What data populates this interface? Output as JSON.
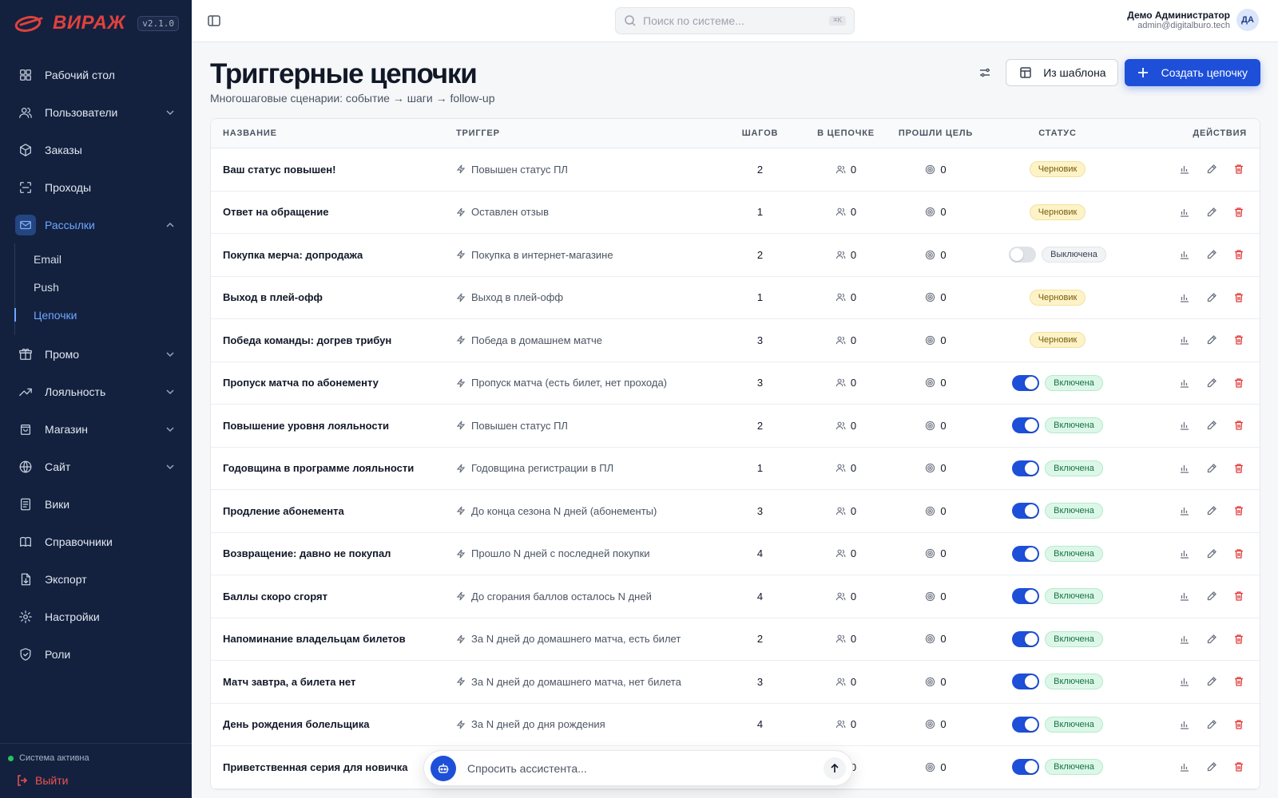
{
  "brand": {
    "name": "ВИРАЖ",
    "version": "v2.1.0"
  },
  "nav": {
    "items": [
      {
        "label": "Рабочий стол",
        "icon": "dashboard-icon"
      },
      {
        "label": "Пользователи",
        "icon": "users-icon",
        "expandable": true
      },
      {
        "label": "Заказы",
        "icon": "box-icon"
      },
      {
        "label": "Проходы",
        "icon": "scan-icon"
      },
      {
        "label": "Рассылки",
        "icon": "mail-icon",
        "expandable": true,
        "active": true,
        "expanded": true
      },
      {
        "label": "Промо",
        "icon": "gift-icon",
        "expandable": true
      },
      {
        "label": "Лояльность",
        "icon": "trending-up-icon",
        "expandable": true
      },
      {
        "label": "Магазин",
        "icon": "shopping-bag-icon",
        "expandable": true
      },
      {
        "label": "Сайт",
        "icon": "globe-icon",
        "expandable": true
      },
      {
        "label": "Вики",
        "icon": "document-icon"
      },
      {
        "label": "Справочники",
        "icon": "book-icon"
      },
      {
        "label": "Экспорт",
        "icon": "file-export-icon"
      },
      {
        "label": "Настройки",
        "icon": "gear-icon"
      },
      {
        "label": "Роли",
        "icon": "shield-icon"
      }
    ],
    "sub_items": [
      "Email",
      "Push",
      "Цепочки"
    ],
    "active_sub": "Цепочки"
  },
  "footer": {
    "status": "Система активна",
    "logout": "Выйти"
  },
  "search": {
    "placeholder": "Поиск по системе...",
    "shortcut": "⌘K"
  },
  "user": {
    "name": "Демо Администратор",
    "email": "admin@digitalburo.tech",
    "initials": "ДА"
  },
  "page": {
    "title": "Триггерные цепочки",
    "subtitle": "Многошаговые сценарии: событие → шаги → follow-up",
    "from_template": "Из шаблона",
    "create": "Создать цепочку"
  },
  "table": {
    "headers": {
      "name": "НАЗВАНИЕ",
      "trigger": "ТРИГГЕР",
      "steps": "ШАГОВ",
      "in_chain": "В ЦЕПОЧКЕ",
      "passed_goal": "ПРОШЛИ ЦЕЛЬ",
      "status": "СТАТУС",
      "actions": "ДЕЙСТВИЯ"
    },
    "rows": [
      {
        "name": "Ваш статус повышен!",
        "trigger": "Повышен статус ПЛ",
        "steps": "2",
        "in_chain": "0",
        "goal": "0",
        "status": "draft",
        "status_label": "Черновик"
      },
      {
        "name": "Ответ на обращение",
        "trigger": "Оставлен отзыв",
        "steps": "1",
        "in_chain": "0",
        "goal": "0",
        "status": "draft",
        "status_label": "Черновик"
      },
      {
        "name": "Покупка мерча: допродажа",
        "trigger": "Покупка в интернет-магазине",
        "steps": "2",
        "in_chain": "0",
        "goal": "0",
        "status": "off",
        "status_label": "Выключена"
      },
      {
        "name": "Выход в плей-офф",
        "trigger": "Выход в плей-офф",
        "steps": "1",
        "in_chain": "0",
        "goal": "0",
        "status": "draft",
        "status_label": "Черновик"
      },
      {
        "name": "Победа команды: догрев трибун",
        "trigger": "Победа в домашнем матче",
        "steps": "3",
        "in_chain": "0",
        "goal": "0",
        "status": "draft",
        "status_label": "Черновик"
      },
      {
        "name": "Пропуск матча по абонементу",
        "trigger": "Пропуск матча (есть билет, нет прохода)",
        "steps": "3",
        "in_chain": "0",
        "goal": "0",
        "status": "on",
        "status_label": "Включена"
      },
      {
        "name": "Повышение уровня лояльности",
        "trigger": "Повышен статус ПЛ",
        "steps": "2",
        "in_chain": "0",
        "goal": "0",
        "status": "on",
        "status_label": "Включена"
      },
      {
        "name": "Годовщина в программе лояльности",
        "trigger": "Годовщина регистрации в ПЛ",
        "steps": "1",
        "in_chain": "0",
        "goal": "0",
        "status": "on",
        "status_label": "Включена"
      },
      {
        "name": "Продление абонемента",
        "trigger": "До конца сезона N дней (абонементы)",
        "steps": "3",
        "in_chain": "0",
        "goal": "0",
        "status": "on",
        "status_label": "Включена"
      },
      {
        "name": "Возвращение: давно не покупал",
        "trigger": "Прошло N дней с последней покупки",
        "steps": "4",
        "in_chain": "0",
        "goal": "0",
        "status": "on",
        "status_label": "Включена"
      },
      {
        "name": "Баллы скоро сгорят",
        "trigger": "До сгорания баллов осталось N дней",
        "steps": "4",
        "in_chain": "0",
        "goal": "0",
        "status": "on",
        "status_label": "Включена"
      },
      {
        "name": "Напоминание владельцам билетов",
        "trigger": "За N дней до домашнего матча, есть билет",
        "steps": "2",
        "in_chain": "0",
        "goal": "0",
        "status": "on",
        "status_label": "Включена"
      },
      {
        "name": "Матч завтра, а билета нет",
        "trigger": "За N дней до домашнего матча, нет билета",
        "steps": "3",
        "in_chain": "0",
        "goal": "0",
        "status": "on",
        "status_label": "Включена"
      },
      {
        "name": "День рождения болельщика",
        "trigger": "За N дней до дня рождения",
        "steps": "4",
        "in_chain": "0",
        "goal": "0",
        "status": "on",
        "status_label": "Включена"
      },
      {
        "name": "Приветственная серия для новичка",
        "trigger": "",
        "steps": "",
        "in_chain": "0",
        "goal": "0",
        "status": "on",
        "status_label": "Включена"
      }
    ]
  },
  "assistant": {
    "placeholder": "Спросить ассистента..."
  },
  "colors": {
    "sidebar": "#13213f",
    "accent": "#1d4fd8",
    "brand_red": "#e0413c",
    "danger": "#e23b3b"
  }
}
